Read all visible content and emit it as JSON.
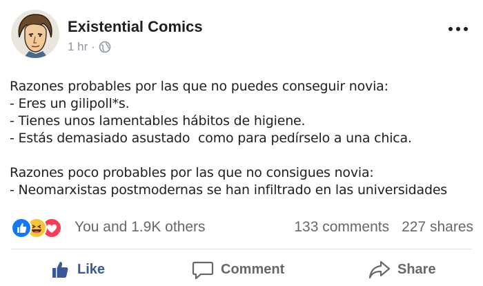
{
  "post": {
    "author": "Existential Comics",
    "time": "1 hr",
    "separator": "·",
    "audience_icon": "globe-icon",
    "menu_icon": "more-options-icon",
    "lines": [
      "Razones probables por las que no puedes conseguir novia:",
      "- Eres un gilipoll*s.",
      "- Tienes unos lamentables hábitos de higiene.",
      "- Estás demasiado asustado  como para pedírselo a una chica.",
      "",
      "Razones poco probables por las que no consigues novia:",
      "- Neomarxistas postmodernas se han infiltrado en las universidades"
    ]
  },
  "reactions": {
    "icons": [
      "like-reaction-icon",
      "haha-reaction-icon",
      "love-reaction-icon"
    ],
    "summary": "You and 1.9K others",
    "comments": "133 comments",
    "shares": "227 shares"
  },
  "actions": {
    "like": "Like",
    "comment": "Comment",
    "share": "Share"
  },
  "colors": {
    "like_blue": "#385898",
    "reaction_blue": "#1877f2",
    "haha_yellow": "#f7c43c",
    "love_red": "#f33e58",
    "muted_text": "#65676b",
    "divider": "#dadde1"
  }
}
